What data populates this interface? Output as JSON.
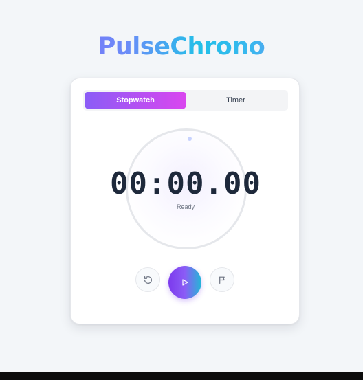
{
  "app": {
    "title": "PulseChrono"
  },
  "tabs": [
    {
      "label": "Stopwatch",
      "active": true
    },
    {
      "label": "Timer",
      "active": false
    }
  ],
  "display": {
    "time": "00:00.00",
    "status": "Ready"
  },
  "controls": {
    "reset_icon": "rotate-ccw-icon",
    "play_icon": "play-icon",
    "lap_icon": "flag-icon"
  },
  "colors": {
    "accent_start": "#8b5cf6",
    "accent_end": "#d946ef",
    "play_end": "#22b8d6",
    "background": "#f3f6f9"
  }
}
